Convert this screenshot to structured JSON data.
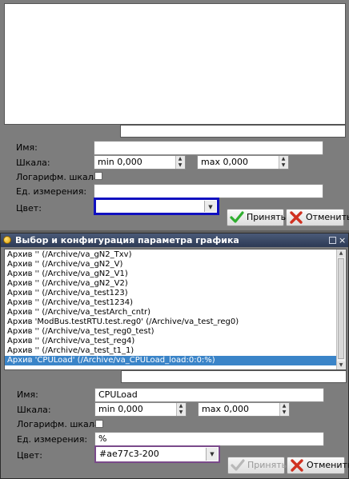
{
  "top_dialog": {
    "labels": {
      "name": "Имя:",
      "scale": "Шкала:",
      "log_scale": "Логарифм. шкала:",
      "units": "Ед. измерения:",
      "color": "Цвет:"
    },
    "name_value": "",
    "scale_min": "min 0,000",
    "scale_max": "max 0,000",
    "log_scale_checked": false,
    "units_value": "",
    "color_value": "",
    "ok_label": "Принять",
    "cancel_label": "Отменить",
    "ok_enabled": true
  },
  "dialog": {
    "title": "Выбор и конфигурация параметра графика",
    "archive_items": [
      "Архив '' (/Archive/va_gN2_Txv)",
      "Архив '' (/Archive/va_gN2_V)",
      "Архив '' (/Archive/va_gN2_V1)",
      "Архив '' (/Archive/va_gN2_V2)",
      "Архив '' (/Archive/va_test123)",
      "Архив '' (/Archive/va_test1234)",
      "Архив '' (/Archive/va_testArch_cntr)",
      "Архив 'ModBus.testRTU.test.reg0' (/Archive/va_test_reg0)",
      "Архив '' (/Archive/va_test_reg0_test)",
      "Архив '' (/Archive/va_test_reg4)",
      "Архив '' (/Archive/va_test_t1_1)",
      "Архив 'CPULoad' (/Archive/va_CPULoad_load:0:0:%)"
    ],
    "selected_index": 11,
    "labels": {
      "name": "Имя:",
      "scale": "Шкала:",
      "log_scale": "Логарифм. шкала:",
      "units": "Ед. измерения:",
      "color": "Цвет:"
    },
    "name_value": "CPULoad",
    "scale_min": "min 0,000",
    "scale_max": "max 0,000",
    "log_scale_checked": false,
    "units_value": "%",
    "color_value": "#ae77c3-200",
    "ok_label": "Принять",
    "cancel_label": "Отменить",
    "ok_enabled": false
  },
  "colors": {
    "focus_border_top": "#1010c0",
    "focus_border_bottom": "#7a4a8a",
    "selection": "#3a84c8",
    "ok_icon": "#2fae2f",
    "cancel_icon": "#d03020"
  },
  "icons": {
    "ok": "checkmark-icon",
    "cancel": "cross-icon",
    "window": "app-icon"
  }
}
